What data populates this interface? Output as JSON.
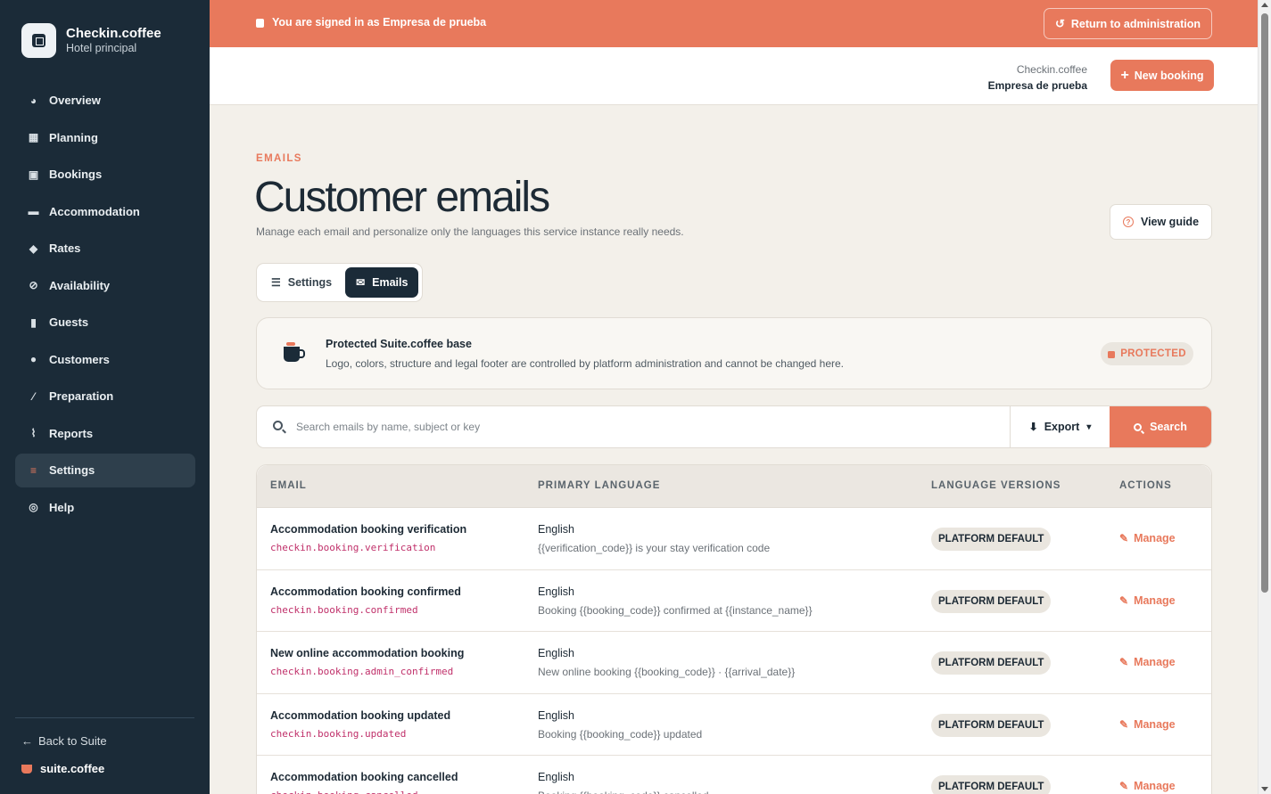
{
  "sidebar": {
    "brand_name": "Checkin.coffee",
    "brand_sub": "Hotel principal",
    "items": [
      {
        "label": "Overview",
        "icon": "pie-chart-icon"
      },
      {
        "label": "Planning",
        "icon": "calendar-icon"
      },
      {
        "label": "Bookings",
        "icon": "calendar-check-icon"
      },
      {
        "label": "Accommodation",
        "icon": "bed-icon"
      },
      {
        "label": "Rates",
        "icon": "tags-icon"
      },
      {
        "label": "Availability",
        "icon": "ban-icon"
      },
      {
        "label": "Guests",
        "icon": "suitcase-icon"
      },
      {
        "label": "Customers",
        "icon": "users-icon"
      },
      {
        "label": "Preparation",
        "icon": "broom-icon"
      },
      {
        "label": "Reports",
        "icon": "line-chart-icon"
      },
      {
        "label": "Settings",
        "icon": "sliders-icon",
        "active": true
      },
      {
        "label": "Help",
        "icon": "lifebuoy-icon"
      }
    ],
    "back_label": "Back to Suite",
    "suite_label": "suite.coffee"
  },
  "banner": {
    "message": "You are signed in as Empresa de prueba",
    "return_label": "Return to administration"
  },
  "header": {
    "account_line1": "Checkin.coffee",
    "account_line2": "Empresa de prueba",
    "new_booking_label": "New booking"
  },
  "page": {
    "eyebrow": "EMAILS",
    "title": "Customer emails",
    "description": "Manage each email and personalize only the languages this service instance really needs.",
    "guide_label": "View guide"
  },
  "tabs": {
    "settings_label": "Settings",
    "emails_label": "Emails"
  },
  "protected": {
    "title": "Protected Suite.coffee base",
    "description": "Logo, colors, structure and legal footer are controlled by platform administration and cannot be changed here.",
    "badge": "PROTECTED"
  },
  "search": {
    "placeholder": "Search emails by name, subject or key",
    "export_label": "Export",
    "search_label": "Search"
  },
  "table": {
    "headers": {
      "email": "EMAIL",
      "primary_language": "PRIMARY LANGUAGE",
      "language_versions": "LANGUAGE VERSIONS",
      "actions": "ACTIONS"
    },
    "rows": [
      {
        "name": "Accommodation booking verification",
        "key": "checkin.booking.verification",
        "language": "English",
        "subject": "{{verification_code}} is your stay verification code",
        "badge": "PLATFORM DEFAULT",
        "action": "Manage"
      },
      {
        "name": "Accommodation booking confirmed",
        "key": "checkin.booking.confirmed",
        "language": "English",
        "subject": "Booking {{booking_code}} confirmed at {{instance_name}}",
        "badge": "PLATFORM DEFAULT",
        "action": "Manage"
      },
      {
        "name": "New online accommodation booking",
        "key": "checkin.booking.admin_confirmed",
        "language": "English",
        "subject": "New online booking {{booking_code}} · {{arrival_date}}",
        "badge": "PLATFORM DEFAULT",
        "action": "Manage"
      },
      {
        "name": "Accommodation booking updated",
        "key": "checkin.booking.updated",
        "language": "English",
        "subject": "Booking {{booking_code}} updated",
        "badge": "PLATFORM DEFAULT",
        "action": "Manage"
      },
      {
        "name": "Accommodation booking cancelled",
        "key": "checkin.booking.cancelled",
        "language": "English",
        "subject": "Booking {{booking_code}} cancelled",
        "badge": "PLATFORM DEFAULT",
        "action": "Manage"
      }
    ]
  },
  "colors": {
    "accent": "#e8795c",
    "sidebar_bg": "#1b2b38",
    "page_bg": "#f3f0ea",
    "key_text": "#c0306a"
  }
}
